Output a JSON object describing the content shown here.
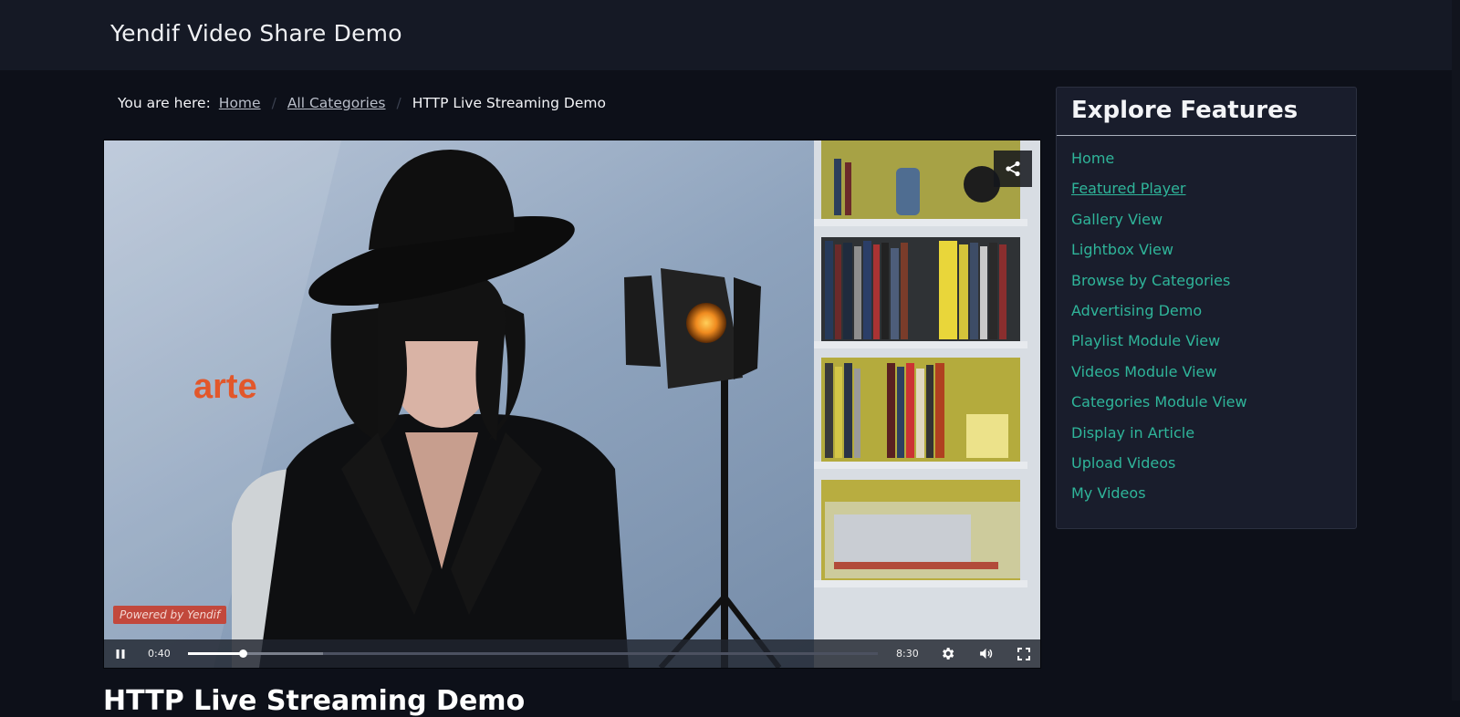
{
  "site": {
    "title": "Yendif Video Share Demo"
  },
  "breadcrumb": {
    "label": "You are here:",
    "items": [
      "Home",
      "All Categories"
    ],
    "current": "HTTP Live Streaming Demo"
  },
  "player": {
    "watermark": "arte",
    "powered_by": "Powered by Yendif",
    "current_time": "0:40",
    "duration": "8:30",
    "progress_fraction": 0.08,
    "buffered_fraction": 0.196,
    "icons": {
      "share": "share-icon",
      "play_pause": "pause-icon",
      "settings": "gear-icon",
      "volume": "volume-icon",
      "fullscreen": "fullscreen-icon"
    }
  },
  "video_title": "HTTP Live Streaming Demo",
  "sidebar": {
    "title": "Explore Features",
    "items": [
      "Home",
      "Featured Player",
      "Gallery View",
      "Lightbox View",
      "Browse by Categories",
      "Advertising Demo",
      "Playlist Module View",
      "Videos Module View",
      "Categories Module View",
      "Display in Article",
      "Upload Videos",
      "My Videos"
    ],
    "active_index": 1
  },
  "colors": {
    "background": "#0d1019",
    "header": "#151925",
    "link_accent": "#2fb59a",
    "sidebar_bg": "#191d2c",
    "powered_badge": "#c2483c"
  }
}
